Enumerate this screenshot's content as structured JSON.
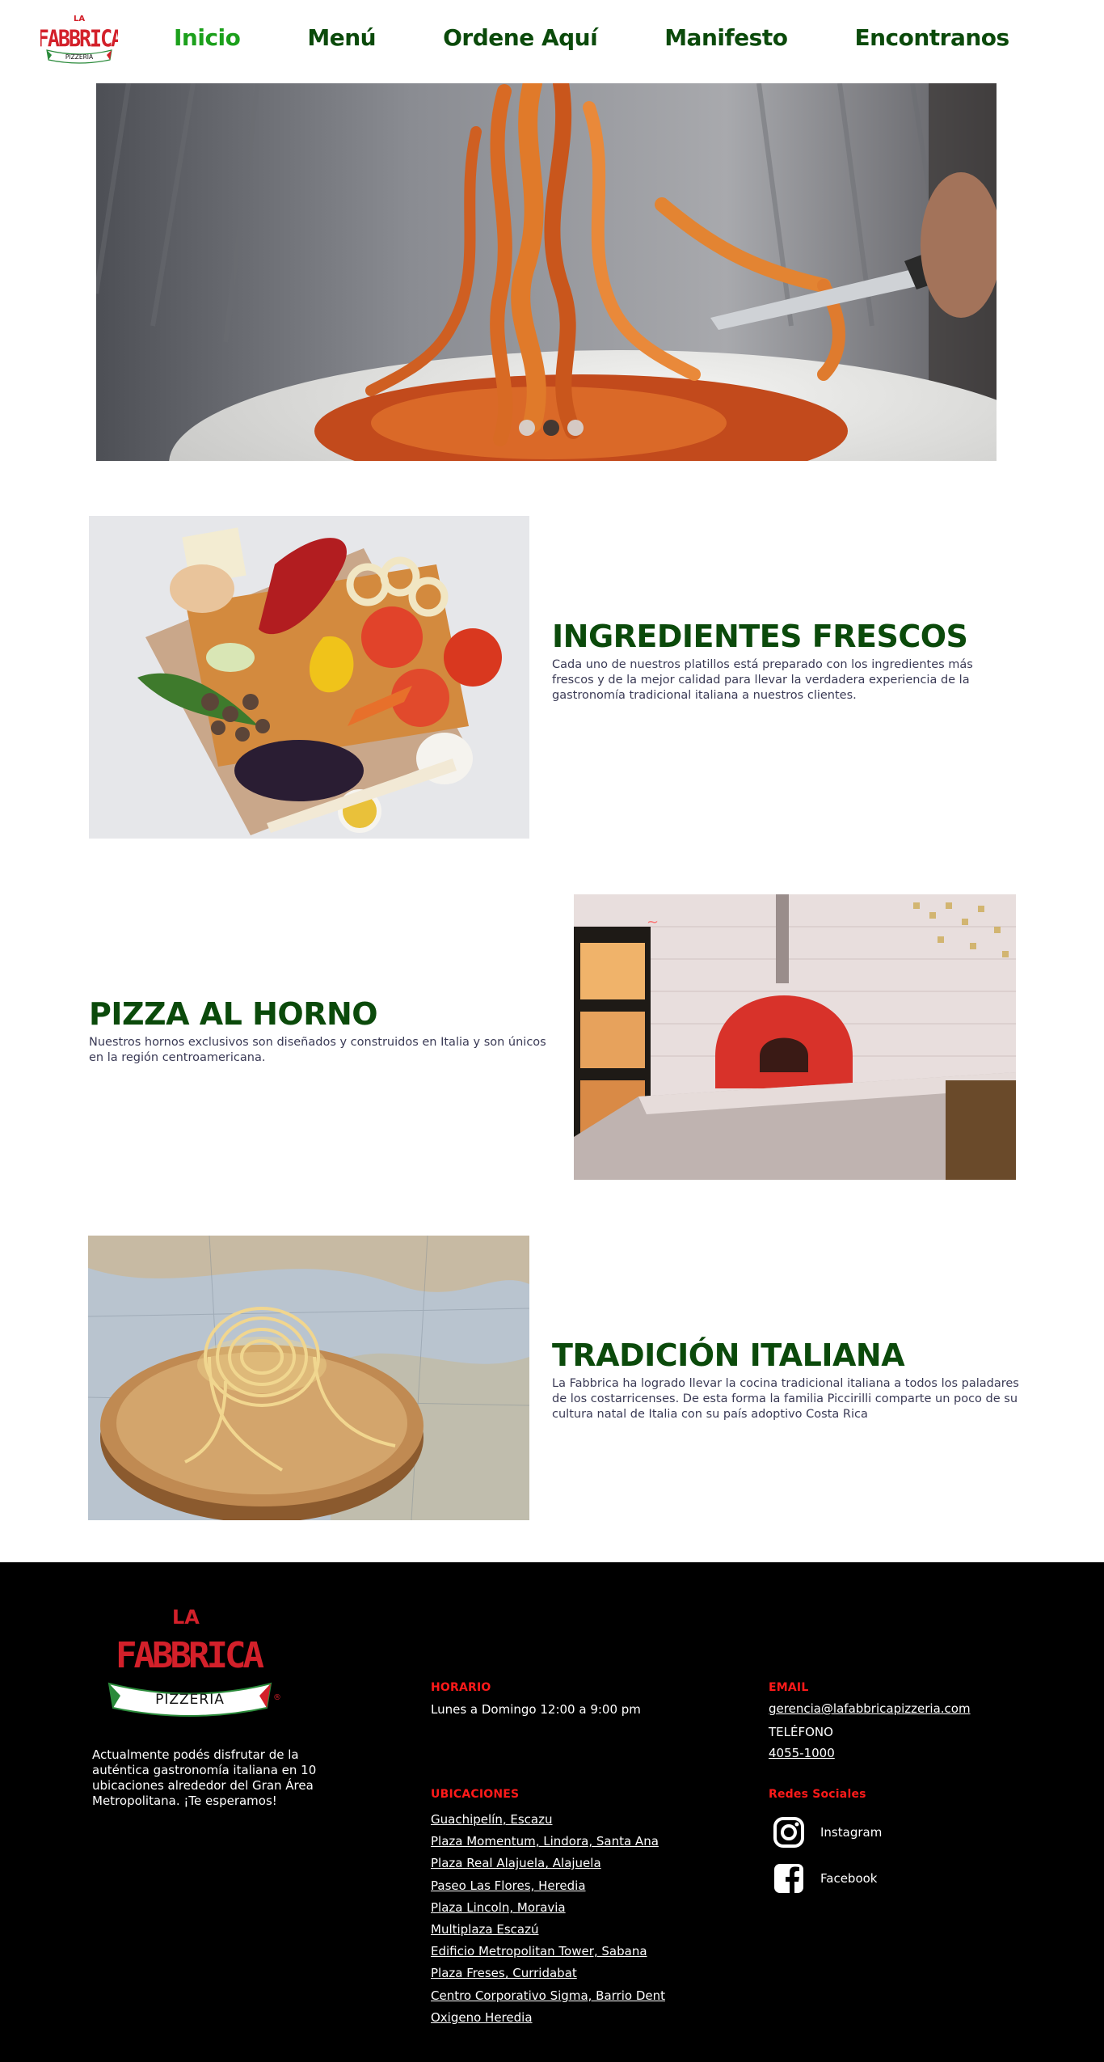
{
  "header": {
    "logo_alt": "La Fabbrica Pizzeria",
    "nav": [
      {
        "label": "Inicio",
        "active": true
      },
      {
        "label": "Menú",
        "active": false
      },
      {
        "label": "Ordene Aquí",
        "active": false
      },
      {
        "label": "Manifesto",
        "active": false
      },
      {
        "label": "Encontranos",
        "active": false
      }
    ]
  },
  "hero": {
    "image": "pasta-fettuccine-fork-knife-photo",
    "slides": 3,
    "active_slide": 2
  },
  "features": [
    {
      "title": "INGREDIENTES FRESCOS",
      "text": "Cada uno de nuestros platillos está preparado con los ingredientes más frescos y de la mejor calidad para llevar la verdadera experiencia de la gastronomía tradicional italiana a nuestros clientes.",
      "image": "fresh-vegetables-cutting-board-photo"
    },
    {
      "title": "PIZZA AL HORNO",
      "text": "Nuestros hornos exclusivos son diseñados y construidos en Italia y son únicos en la región centroamericana.",
      "image": "red-pizza-oven-restaurant-photo"
    },
    {
      "title": "TRADICIÓN ITALIANA",
      "text": "La Fabbrica ha logrado llevar la cocina tradicional italiana a todos los paladares de los costarricenses. De esta forma la familia Piccirilli comparte un poco de su cultura natal de Italia con su país adoptivo Costa Rica",
      "image": "fresh-pasta-nest-wooden-board-map-photo"
    }
  ],
  "footer": {
    "logo": {
      "la": "LA",
      "name": "FABBRICA",
      "banner": "PIZZERIA",
      "reg": "®"
    },
    "about": "Actualmente podés disfrutar de la auténtica gastronomía italiana en 10 ubicaciones alrededor del Gran Área Metropolitana. ¡Te esperamos!",
    "horario_label": "HORARIO",
    "horario": "Lunes a Domingo 12:00 a 9:00 pm",
    "ubicaciones_label": "UBICACIONES",
    "ubicaciones": [
      "Guachipelín, Escazu",
      "Plaza Momentum, Lindora, Santa Ana",
      "Plaza Real Alajuela, Alajuela",
      "Paseo Las Flores, Heredia",
      "Plaza Lincoln, Moravia",
      "Multiplaza Escazú",
      "Edificio Metropolitan Tower, Sabana",
      "Plaza Freses, Curridabat",
      "Centro Corporativo Sigma, Barrio Dent",
      "Oxigeno Heredia"
    ],
    "email_label": "EMAIL",
    "email": "gerencia@lafabbricapizzeria.com",
    "telefono_label": "TELÉFONO",
    "telefono": "4055-1000",
    "redes_label": "Redes Sociales",
    "instagram_label": "Instagram",
    "facebook_label": "Facebook"
  },
  "colors": {
    "nav_green": "#0b4a0b",
    "nav_active": "#1ca01c",
    "footer_bg": "#000000",
    "footer_heading": "#ff1a1a",
    "logo_red": "#d3202a"
  }
}
